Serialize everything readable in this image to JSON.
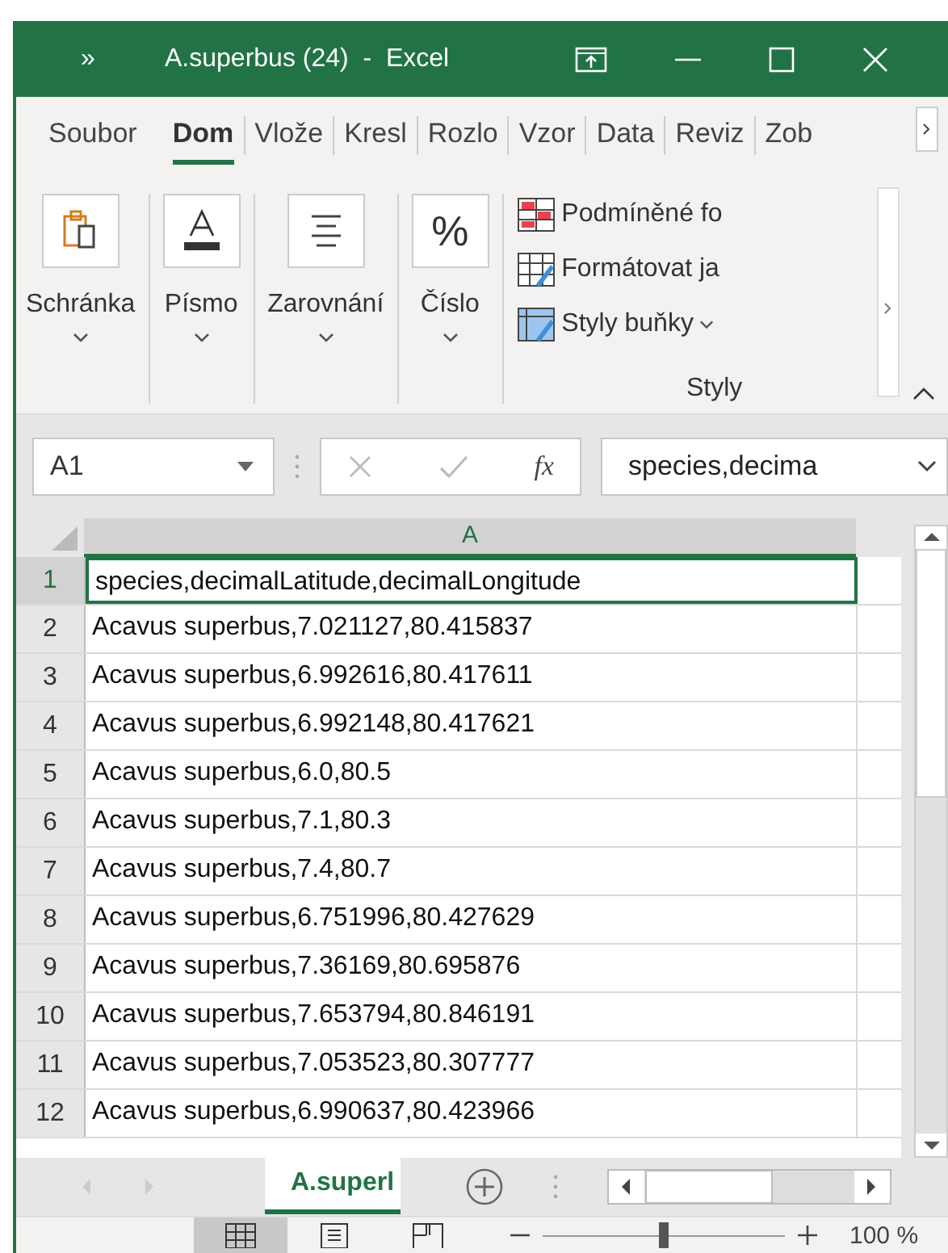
{
  "window": {
    "title": "A.superbus (24)  -  Excel",
    "overflow": "»"
  },
  "tabs": [
    {
      "label": "Soubor",
      "selected": false
    },
    {
      "label": "Dom",
      "selected": true
    },
    {
      "label": "Vlože",
      "selected": false
    },
    {
      "label": "Kresl",
      "selected": false
    },
    {
      "label": "Rozlo",
      "selected": false
    },
    {
      "label": "Vzor",
      "selected": false
    },
    {
      "label": "Data",
      "selected": false
    },
    {
      "label": "Reviz",
      "selected": false
    },
    {
      "label": "Zob",
      "selected": false
    }
  ],
  "ribbon": {
    "groups": [
      {
        "kind": "clipboard",
        "label": "Schránka"
      },
      {
        "kind": "font",
        "label": "Písmo"
      },
      {
        "kind": "align",
        "label": "Zarovnání"
      },
      {
        "kind": "number",
        "label": "Číslo",
        "icon_text": "%"
      }
    ],
    "styles": {
      "items": [
        {
          "kind": "conditional",
          "label": "Podmíněné fo"
        },
        {
          "kind": "table",
          "label": "Formátovat ja"
        },
        {
          "kind": "cell",
          "label": "Styly buňky"
        }
      ],
      "label": "Styly"
    }
  },
  "formula_bar": {
    "name_box": "A1",
    "fx": "fx",
    "value": "species,decima"
  },
  "sheet": {
    "column": "A",
    "rows": [
      {
        "n": "1",
        "value": "species,decimalLatitude,decimalLongitude",
        "selected": true
      },
      {
        "n": "2",
        "value": "Acavus superbus,7.021127,80.415837",
        "selected": false
      },
      {
        "n": "3",
        "value": "Acavus superbus,6.992616,80.417611",
        "selected": false
      },
      {
        "n": "4",
        "value": "Acavus superbus,6.992148,80.417621",
        "selected": false
      },
      {
        "n": "5",
        "value": "Acavus superbus,6.0,80.5",
        "selected": false
      },
      {
        "n": "6",
        "value": "Acavus superbus,7.1,80.3",
        "selected": false
      },
      {
        "n": "7",
        "value": "Acavus superbus,7.4,80.7",
        "selected": false
      },
      {
        "n": "8",
        "value": "Acavus superbus,6.751996,80.427629",
        "selected": false
      },
      {
        "n": "9",
        "value": "Acavus superbus,7.36169,80.695876",
        "selected": false
      },
      {
        "n": "10",
        "value": "Acavus superbus,7.653794,80.846191",
        "selected": false
      },
      {
        "n": "11",
        "value": "Acavus superbus,7.053523,80.307777",
        "selected": false
      },
      {
        "n": "12",
        "value": "Acavus superbus,6.990637,80.423966",
        "selected": false
      }
    ]
  },
  "sheet_tabs": [
    {
      "label": "A.superl",
      "selected": true
    }
  ],
  "status_bar": {
    "views": [
      {
        "kind": "normal",
        "selected": true
      },
      {
        "kind": "layout",
        "selected": false
      },
      {
        "kind": "pagebreak",
        "selected": false
      }
    ],
    "zoom": {
      "level": 0.5,
      "reading": "100 %"
    }
  }
}
